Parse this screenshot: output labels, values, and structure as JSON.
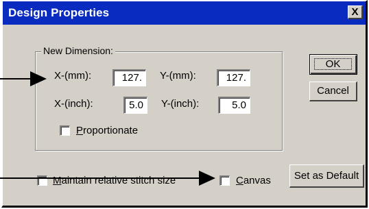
{
  "window": {
    "title": "Design Properties",
    "close_glyph": "X"
  },
  "group": {
    "label": "New Dimension:",
    "x_mm_label": "X-(mm):",
    "x_mm_value": "127.",
    "y_mm_label": "Y-(mm):",
    "y_mm_value": "127.",
    "x_inch_label": "X-(inch):",
    "x_inch_value": "5.0",
    "y_inch_label": "Y-(inch):",
    "y_inch_value": "5.0",
    "proportionate_label": "Proportionate",
    "proportionate_checked": false
  },
  "options": {
    "maintain_label": "Maintain relative stitch size",
    "maintain_checked": false,
    "canvas_label": "Canvas",
    "canvas_checked": false
  },
  "buttons": {
    "ok": "OK",
    "cancel": "Cancel",
    "set_default": "Set as Default"
  },
  "colors": {
    "title_bar": "#0a2bbf",
    "face": "#d4d0c8",
    "annotation_arrow": "#000000"
  },
  "icons": [
    "close-icon",
    "annotation-arrow-icon"
  ]
}
